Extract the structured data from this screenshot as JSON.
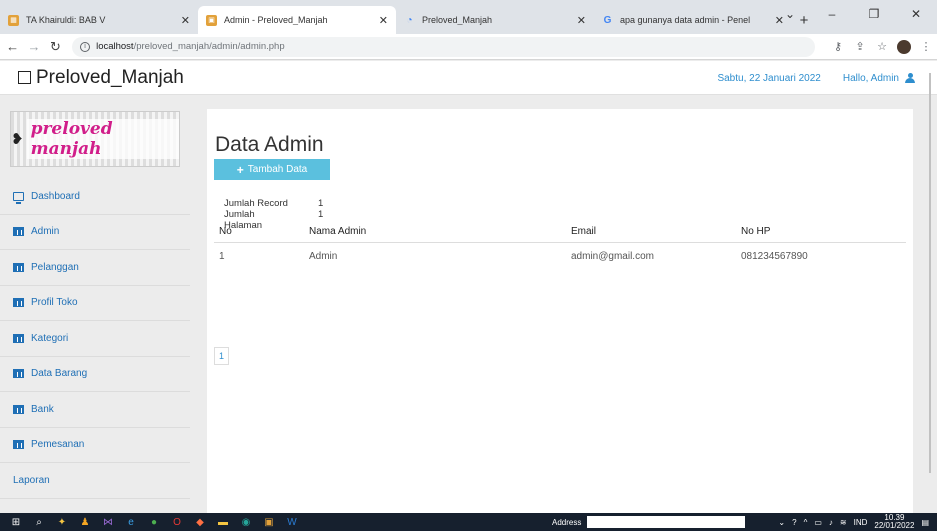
{
  "browser": {
    "tabs": [
      {
        "title": "TA Khairuldi: BAB V",
        "active": false,
        "icon": "sheet-icon",
        "color": "#e2a13a"
      },
      {
        "title": "Admin - Preloved_Manjah",
        "active": true,
        "icon": "admin-favicon",
        "color": "#e2a13a"
      },
      {
        "title": "Preloved_Manjah",
        "active": false,
        "icon": "loading-icon",
        "color": "#3b82f6"
      },
      {
        "title": "apa gunanya data admin - Penel",
        "active": false,
        "icon": "google-icon",
        "color": "#4285f4"
      }
    ],
    "url_host": "localhost",
    "url_path": "/preloved_manjah/admin/admin.php"
  },
  "nav": {
    "brand": "Preloved_Manjah",
    "date": "Sabtu, 22 Januari 2022",
    "greeting": "Hallo, Admin"
  },
  "sidebar": {
    "logo_text": "preloved manjah",
    "items": [
      {
        "label": "Dashboard",
        "icon": "desktop-icon"
      },
      {
        "label": "Admin",
        "icon": "table-icon"
      },
      {
        "label": "Pelanggan",
        "icon": "table-icon"
      },
      {
        "label": "Profil Toko",
        "icon": "table-icon"
      },
      {
        "label": "Kategori",
        "icon": "table-icon"
      },
      {
        "label": "Data Barang",
        "icon": "table-icon"
      },
      {
        "label": "Bank",
        "icon": "table-icon"
      },
      {
        "label": "Pemesanan",
        "icon": "table-icon"
      },
      {
        "label": "Laporan",
        "icon": ""
      }
    ]
  },
  "main": {
    "title": "Data Admin",
    "add_button": "Tambah Data",
    "record_label": "Jumlah Record",
    "record_value": "1",
    "pages_label": "Jumlah Halaman",
    "pages_value": "1",
    "columns": [
      "No",
      "Nama Admin",
      "Email",
      "No HP"
    ],
    "rows": [
      [
        "1",
        "Admin",
        "admin@gmail.com",
        "081234567890"
      ]
    ],
    "page_number": "1"
  },
  "taskbar": {
    "address_label": "Address",
    "lang": "IND",
    "time": "10.39",
    "date": "22/01/2022"
  },
  "colors": {
    "accent": "#2e8ece",
    "button": "#5bc0de",
    "sidebar_link": "#1f6fb5"
  }
}
